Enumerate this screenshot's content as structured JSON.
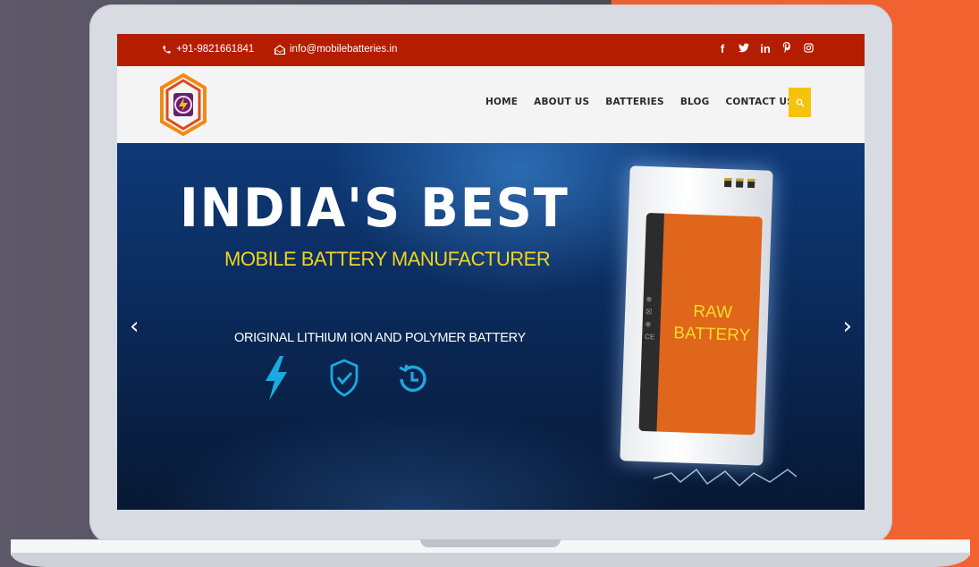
{
  "topbar": {
    "phone": "+91-9821661841",
    "email": "info@mobilebatteries.in",
    "socials": [
      "facebook-icon",
      "twitter-icon",
      "linkedin-icon",
      "pinterest-icon",
      "instagram-icon"
    ]
  },
  "nav": {
    "items": [
      "HOME",
      "ABOUT US",
      "BATTERIES",
      "BLOG",
      "CONTACT US"
    ]
  },
  "hero": {
    "title": "INDIA'S BEST",
    "subtitle": "MOBILE BATTERY MANUFACTURER",
    "line": "ORIGINAL LITHIUM ION AND POLYMER BATTERY",
    "battery_line1": "RAW",
    "battery_line2": "BATTERY",
    "icons": [
      "lightning-icon",
      "shield-check-icon",
      "clock-history-icon"
    ]
  },
  "colors": {
    "topbar": "#b51d00",
    "accent_yellow": "#f4c40b",
    "battery_label": "#e0661b"
  }
}
